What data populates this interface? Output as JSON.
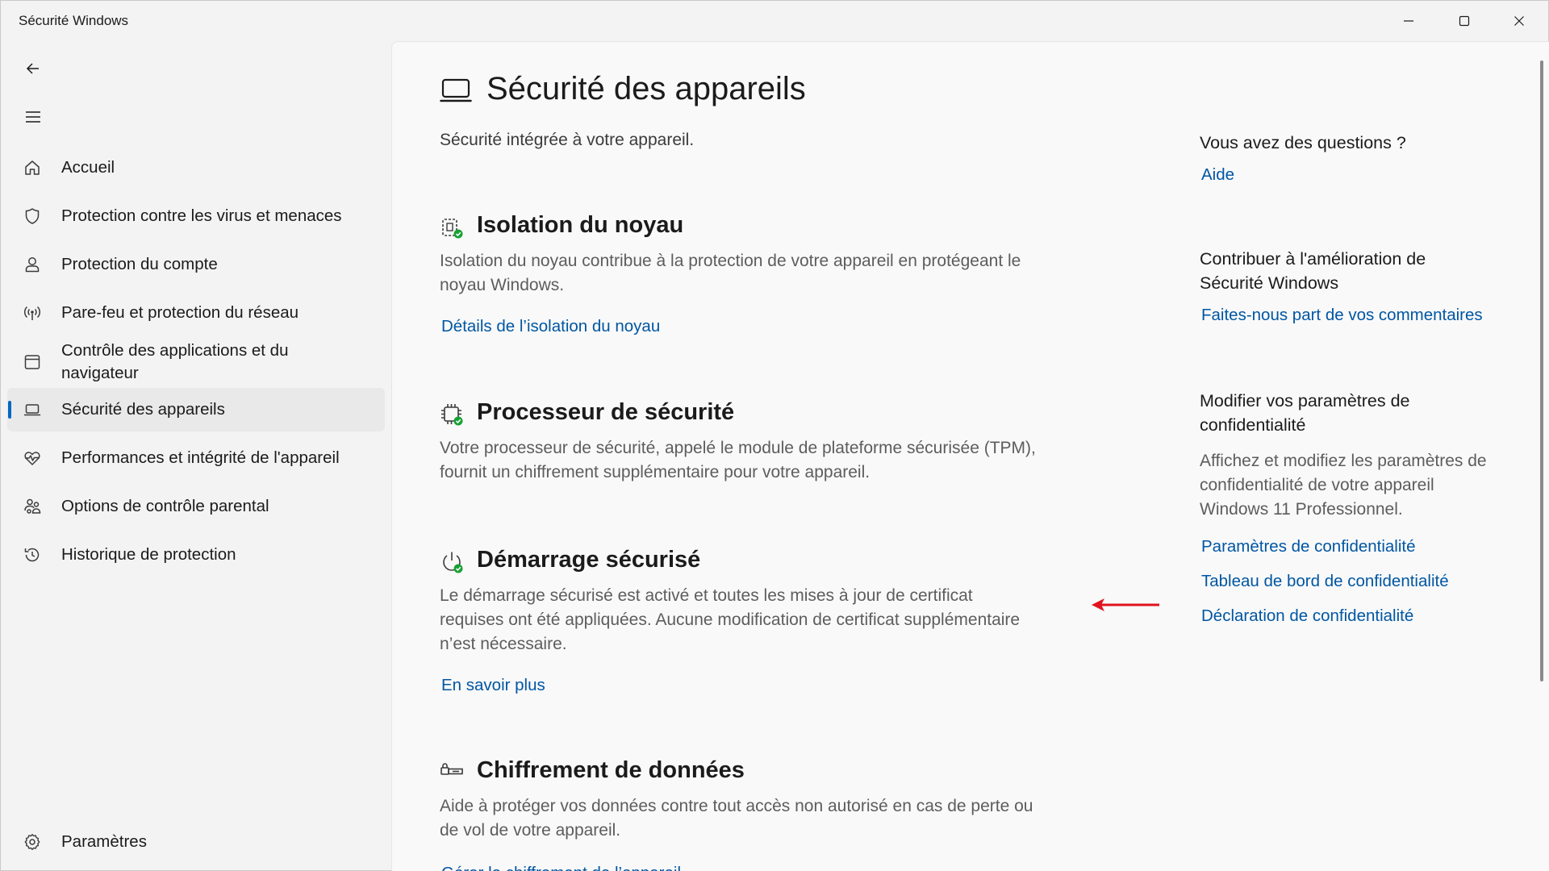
{
  "window": {
    "title": "Sécurité Windows"
  },
  "sidebar": {
    "items": [
      {
        "label": "Accueil",
        "icon": "home-icon"
      },
      {
        "label": "Protection contre les virus et menaces",
        "icon": "shield-icon"
      },
      {
        "label": "Protection du compte",
        "icon": "person-icon"
      },
      {
        "label": "Pare-feu et protection du réseau",
        "icon": "wifi-antenna-icon"
      },
      {
        "label": "Contrôle des applications et du navigateur",
        "icon": "app-browser-icon"
      },
      {
        "label": "Sécurité des appareils",
        "icon": "laptop-icon",
        "selected": true
      },
      {
        "label": "Performances et intégrité de l'appareil",
        "icon": "heart-pulse-icon"
      },
      {
        "label": "Options de contrôle parental",
        "icon": "family-icon"
      },
      {
        "label": "Historique de protection",
        "icon": "history-icon"
      }
    ],
    "settings": {
      "label": "Paramètres",
      "icon": "gear-icon"
    }
  },
  "main": {
    "title": "Sécurité des appareils",
    "subtitle": "Sécurité intégrée à votre appareil.",
    "sections": [
      {
        "title": "Isolation du noyau",
        "desc": "Isolation du noyau contribue à la protection de votre appareil en protégeant le noyau Windows.",
        "link": "Détails de l’isolation du noyau"
      },
      {
        "title": "Processeur de sécurité",
        "desc": "Votre processeur de sécurité, appelé le module de plateforme sécurisée (TPM), fournit un chiffrement supplémentaire pour votre appareil."
      },
      {
        "title": "Démarrage sécurisé",
        "desc": "Le démarrage sécurisé est activé et toutes les mises à jour de certificat requises ont été appliquées. Aucune modification de certificat supplémentaire n’est nécessaire.",
        "link": "En savoir plus"
      },
      {
        "title": "Chiffrement de données",
        "desc": "Aide à protéger vos données contre tout accès non autorisé en cas de perte ou de vol de votre appareil.",
        "link": "Gérer le chiffrement de l’appareil"
      }
    ]
  },
  "right": {
    "questions": {
      "heading": "Vous avez des questions ?",
      "link": "Aide"
    },
    "feedback": {
      "heading": "Contribuer à l'amélioration de Sécurité Windows",
      "link": "Faites-nous part de vos commentaires"
    },
    "privacy": {
      "heading": "Modifier vos paramètres de confidentialité",
      "text": "Affichez et modifiez les paramètres de confidentialité de votre appareil Windows 11 Professionnel.",
      "links": [
        "Paramètres de confidentialité",
        "Tableau de bord de confidentialité",
        "Déclaration de confidentialité"
      ]
    }
  },
  "colors": {
    "accent": "#0067c0",
    "link": "#0056a3",
    "status_ok": "#17a134",
    "annotation_arrow": "#e0141e"
  }
}
